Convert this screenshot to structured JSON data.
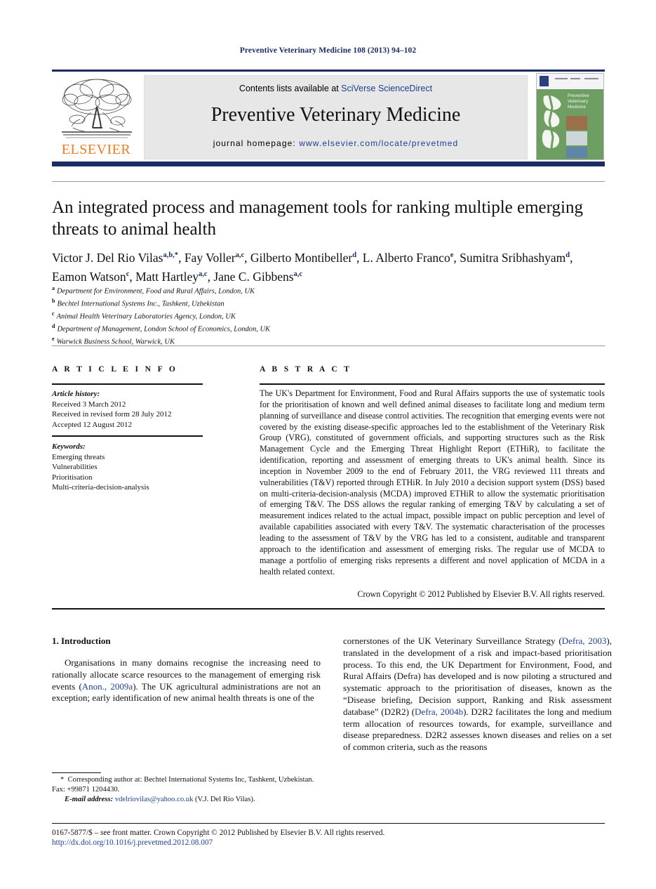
{
  "running_head": "Preventive Veterinary Medicine 108 (2013) 94–102",
  "masthead": {
    "publisher_name": "ELSEVIER",
    "contents_prefix": "Contents lists available at ",
    "contents_link": "SciVerse ScienceDirect",
    "journal_title": "Preventive Veterinary Medicine",
    "homepage_prefix": "journal homepage: ",
    "homepage_url": "www.elsevier.com/locate/prevetmed",
    "cover_title": "Preventive Veterinary Medicine"
  },
  "article": {
    "title": "An integrated process and management tools for ranking multiple emerging threats to animal health",
    "authors_line1": "Victor J. Del Rio Vilas",
    "authors_html": "Victor J. Del Rio Vilas<sup>a,b,*</sup>, Fay Voller<sup>a,c</sup>, Gilberto Montibeller<sup>d</sup>, L. Alberto Franco<sup>e</sup>, Sumitra Sribhashyam<sup>d</sup>, Eamon Watson<sup>c</sup>, Matt Hartley<sup>a,c</sup>, Jane C. Gibbens<sup>a,c</sup>",
    "affiliations": [
      {
        "marker": "a",
        "text": "Department for Environment, Food and Rural Affairs, London, UK"
      },
      {
        "marker": "b",
        "text": "Bechtel International Systems Inc., Tashkent, Uzbekistan"
      },
      {
        "marker": "c",
        "text": "Animal Health Veterinary Laboratories Agency, London, UK"
      },
      {
        "marker": "d",
        "text": "Department of Management, London School of Economics, London, UK"
      },
      {
        "marker": "e",
        "text": "Warwick Business School, Warwick, UK"
      }
    ]
  },
  "article_info": {
    "heading": "A R T I C L E   I N F O",
    "history_label": "Article history:",
    "history": [
      "Received 3 March 2012",
      "Received in revised form 28 July 2012",
      "Accepted 12 August 2012"
    ],
    "keywords_label": "Keywords:",
    "keywords": [
      "Emerging threats",
      "Vulnerabilities",
      "Prioritisation",
      "Multi-criteria-decision-analysis"
    ]
  },
  "abstract": {
    "heading": "A B S T R A C T",
    "text": "The UK's Department for Environment, Food and Rural Affairs supports the use of systematic tools for the prioritisation of known and well defined animal diseases to facilitate long and medium term planning of surveillance and disease control activities. The recognition that emerging events were not covered by the existing disease-specific approaches led to the establishment of the Veterinary Risk Group (VRG), constituted of government officials, and supporting structures such as the Risk Management Cycle and the Emerging Threat Highlight Report (ETHiR), to facilitate the identification, reporting and assessment of emerging threats to UK's animal health. Since its inception in November 2009 to the end of February 2011, the VRG reviewed 111 threats and vulnerabilities (T&V) reported through ETHiR. In July 2010 a decision support system (DSS) based on multi-criteria-decision-analysis (MCDA) improved ETHiR to allow the systematic prioritisation of emerging T&V. The DSS allows the regular ranking of emerging T&V by calculating a set of measurement indices related to the actual impact, possible impact on public perception and level of available capabilities associated with every T&V. The systematic characterisation of the processes leading to the assessment of T&V by the VRG has led to a consistent, auditable and transparent approach to the identification and assessment of emerging risks. The regular use of MCDA to manage a portfolio of emerging risks represents a different and novel application of MCDA in a health related context.",
    "copyright": "Crown Copyright © 2012 Published by Elsevier B.V. All rights reserved."
  },
  "body": {
    "section_number_title": "1.  Introduction",
    "left_column_html": "<p>Organisations in many domains recognise the increasing need to rationally allocate scarce resources to the management of emerging risk events (<span class=\"ref\">Anon., 2009a</span>). The UK agricultural administrations are not an exception; early identification of new animal health threats is one of the</p>",
    "right_column_html": "<p style=\"text-indent:0\">cornerstones of the UK Veterinary Surveillance Strategy (<span class=\"ref\">Defra, 2003</span>), translated in the development of a risk and impact-based prioritisation process. To this end, the UK Department for Environment, Food, and Rural Affairs (Defra) has developed and is now piloting a structured and systematic approach to the prioritisation of diseases, known as the &#8220;Disease briefing, Decision support, Ranking and Risk assessment database&#8221; (D2R2) (<span class=\"ref\">Defra, 2004b</span>). D2R2 facilitates the long and medium term allocation of resources towards, for example, surveillance and disease preparedness. D2R2 assesses known diseases and relies on a set of common criteria, such as the reasons</p>"
  },
  "footnotes": {
    "corresponding_html": "<span class=\"star\">*</span>&nbsp; Corresponding author at: Bechtel International Systems Inc, Tashkent, Uzbekistan. Fax: +99871 1204430.",
    "email_label": "E-mail address:",
    "email": "vdelriovilas@yahoo.co.uk",
    "email_suffix": "(V.J. Del Rio Vilas)."
  },
  "footer": {
    "issn_line": "0167-5877/$ – see front matter. Crown Copyright © 2012 Published by Elsevier B.V. All rights reserved.",
    "doi": "http://dx.doi.org/10.1016/j.prevetmed.2012.08.007"
  },
  "colors": {
    "navy": "#1b2c63",
    "link_blue": "#1c3f94",
    "elsevier_orange": "#ef7d22",
    "masthead_grey": "#e7e7e7",
    "cover_green": "#6f9e63"
  }
}
